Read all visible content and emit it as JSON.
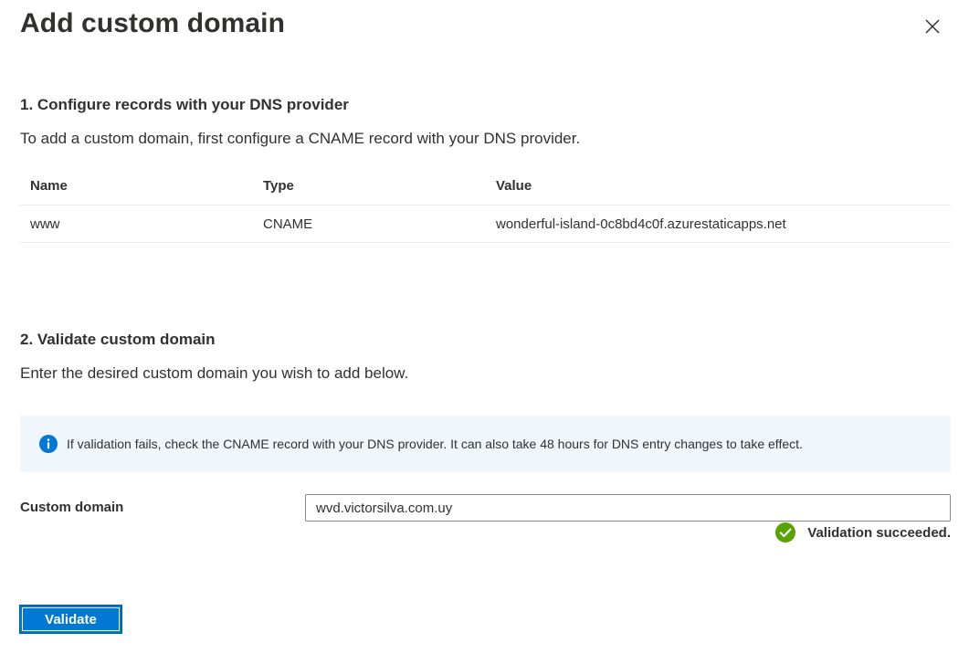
{
  "dialog": {
    "title": "Add custom domain",
    "close_icon": "close-icon"
  },
  "step1": {
    "heading": "1. Configure records with your DNS provider",
    "description": "To add a custom domain, first configure a CNAME record with your DNS provider.",
    "table": {
      "columns": [
        "Name",
        "Type",
        "Value"
      ],
      "rows": [
        [
          "www",
          "CNAME",
          "wonderful-island-0c8bd4c0f.azurestaticapps.net"
        ]
      ]
    }
  },
  "step2": {
    "heading": "2. Validate custom domain",
    "description": "Enter the desired custom domain you wish to add below.",
    "info": {
      "icon": "info-icon",
      "text": "If validation fails, check the CNAME record with your DNS provider. It can also take 48 hours for DNS entry changes to take effect."
    },
    "field": {
      "label": "Custom domain",
      "value": "wvd.victorsilva.com.uy"
    },
    "validation": {
      "icon": "check-circle-icon",
      "text": "Validation succeeded."
    },
    "validate_button": "Validate"
  },
  "colors": {
    "primary": "#0078d4",
    "info_background": "#eff6fc",
    "success": "#57a300",
    "text": "#323130"
  }
}
